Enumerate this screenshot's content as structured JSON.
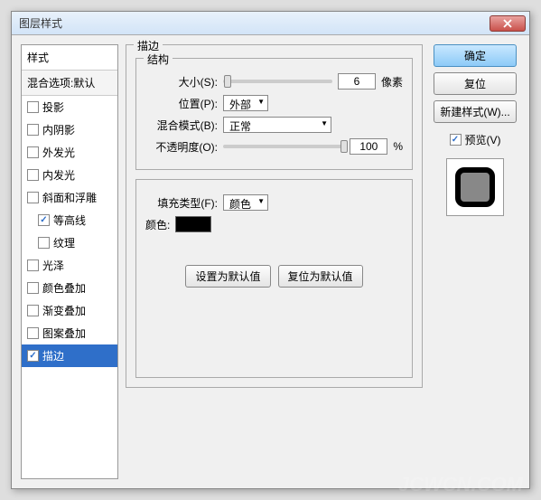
{
  "title": "图层样式",
  "leftPanel": {
    "header": "样式",
    "subheader": "混合选项:默认",
    "items": [
      {
        "label": "投影",
        "checked": false,
        "sub": false
      },
      {
        "label": "内阴影",
        "checked": false,
        "sub": false
      },
      {
        "label": "外发光",
        "checked": false,
        "sub": false
      },
      {
        "label": "内发光",
        "checked": false,
        "sub": false
      },
      {
        "label": "斜面和浮雕",
        "checked": false,
        "sub": false
      },
      {
        "label": "等高线",
        "checked": true,
        "sub": true
      },
      {
        "label": "纹理",
        "checked": false,
        "sub": true
      },
      {
        "label": "光泽",
        "checked": false,
        "sub": false
      },
      {
        "label": "颜色叠加",
        "checked": false,
        "sub": false
      },
      {
        "label": "渐变叠加",
        "checked": false,
        "sub": false
      },
      {
        "label": "图案叠加",
        "checked": false,
        "sub": false
      },
      {
        "label": "描边",
        "checked": true,
        "sub": false,
        "selected": true
      }
    ]
  },
  "center": {
    "groupLabel": "描边",
    "structLabel": "结构",
    "sizeLabel": "大小(S):",
    "sizeValue": "6",
    "sizeUnit": "像素",
    "positionLabel": "位置(P):",
    "positionValue": "外部",
    "blendLabel": "混合模式(B):",
    "blendValue": "正常",
    "opacityLabel": "不透明度(O):",
    "opacityValue": "100",
    "opacityUnit": "%",
    "fillTypeLabel": "填充类型(F):",
    "fillTypeValue": "颜色",
    "colorLabel": "颜色:",
    "colorValue": "#000000",
    "setDefault": "设置为默认值",
    "resetDefault": "复位为默认值"
  },
  "right": {
    "ok": "确定",
    "reset": "复位",
    "newStyle": "新建样式(W)...",
    "previewLabel": "预览(V)",
    "previewChecked": true
  },
  "watermark": "JCWCN.COM"
}
